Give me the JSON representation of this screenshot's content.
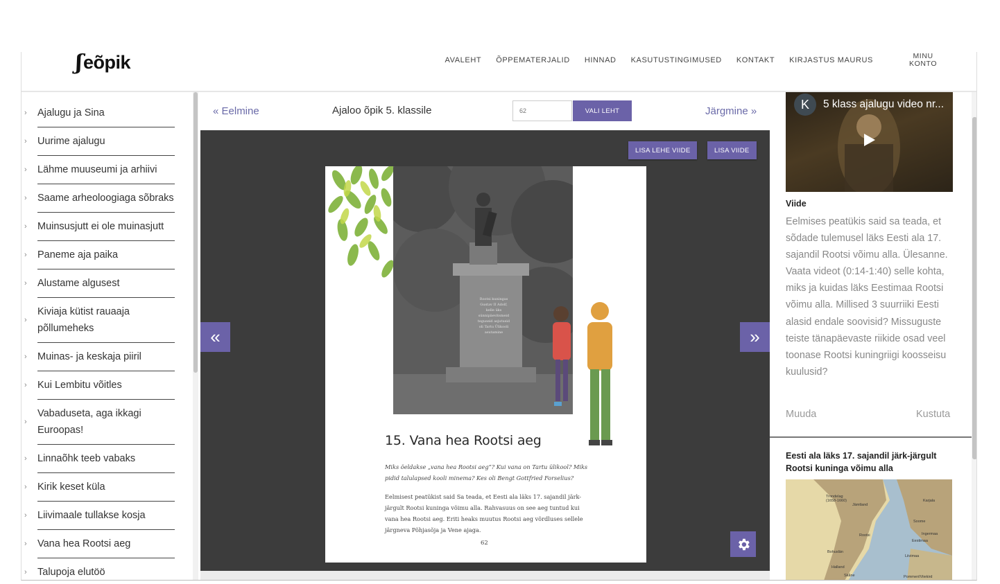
{
  "header": {
    "logo_text": "eõpik",
    "nav": [
      "AVALEHT",
      "ÕPPEMATERJALID",
      "HINNAD",
      "KASUTUSTINGIMUSED",
      "KONTAKT",
      "KIRJASTUS MAURUS"
    ],
    "account_line1": "MINU",
    "account_line2": "KONTO"
  },
  "sidebar": {
    "items": [
      "Ajalugu ja Sina",
      "Uurime ajalugu",
      "Lähme muuseumi ja arhiivi",
      "Saame arheoloogiaga sõbraks",
      "Muinsusjutt ei ole muinasjutt",
      "Paneme aja paika",
      "Alustame algusest",
      "Kiviaja kütist rauaaja põllumeheks",
      "Muinas- ja keskaja piiril",
      "Kui Lembitu võitles",
      "Vabaduseta, aga ikkagi Euroopas!",
      "Linnaõhk teeb vabaks",
      "Kirik keset küla",
      "Liivimaale tullakse kosja",
      "Vana hea Rootsi aeg",
      "Talupoja elutöö"
    ]
  },
  "bookbar": {
    "prev": "« Eelmine",
    "title": "Ajaloo õpik 5. klassile",
    "page_placeholder": "62",
    "choose_button": "VALI LEHT",
    "next": "Järgmine »"
  },
  "viewer": {
    "add_page_ref": "LISA LEHE VIIDE",
    "add_ref": "LISA VIIDE",
    "prev_arrow": "«",
    "next_arrow": "»"
  },
  "book_page": {
    "statue_inscription": [
      "Rootsi kuningas",
      "Gustav II Adolf,",
      "kelle üks",
      "sünnipäevitsmeid",
      "teguseid asjutusid",
      "oli Tartu Ülikooli",
      "asutamine"
    ],
    "heading": "15. Vana hea Rootsi aeg",
    "question": "Miks öeldakse „vana hea Rootsi aeg“? Kui vana on Tartu ülikool? Miks pidid talulapsed kooli minema? Kes oli Bengt Gottfried Forselius?",
    "body": "Eelmisest peatükist said Sa teada, et Eesti ala läks 17. sajandil järk-järgult Rootsi kuninga võimu alla. Rahvasuus on see aeg tuntud kui vana hea Rootsi aeg. Eriti heaks muutus Rootsi aeg võrdluses sellele järgneva Põhjasõja ja Vene ajaga.",
    "page_number": "62"
  },
  "right_panel": {
    "video_avatar": "K",
    "video_title": "5 klass ajalugu video nr...",
    "ref_label": "Viide",
    "ref_text": "Eelmises peatükis said sa teada, et sõdade tulemusel läks Eesti ala 17. sajandil Rootsi võimu alla. Ülesanne. Vaata videot (0:14-1:40) selle kohta, miks ja kuidas läks Eestimaa Rootsi võimu alla. Millised 3 suurriiki Eesti alasid endale soovisid? Missuguste teiste tänapäevaste riikide osad veel toonase Rootsi kuningriigi koosseisu kuulusid?",
    "edit": "Muuda",
    "delete": "Kustuta",
    "card_title": "Eesti ala läks 17. sajandil järk-järgult Rootsi kuninga võimu alla",
    "map_labels": [
      "Trondelag (1658-1660)",
      "Jämtland",
      "Karjala",
      "Soome",
      "Rootsi",
      "Ingermaa",
      "Eestimaa",
      "Liivimaa",
      "Bohuslän",
      "Halland",
      "Skåne",
      "Pommeri/Viiekird"
    ]
  },
  "colors": {
    "accent": "#6b62a8",
    "viewer_bg": "#3c3c3c",
    "link": "#6a6aa8"
  }
}
